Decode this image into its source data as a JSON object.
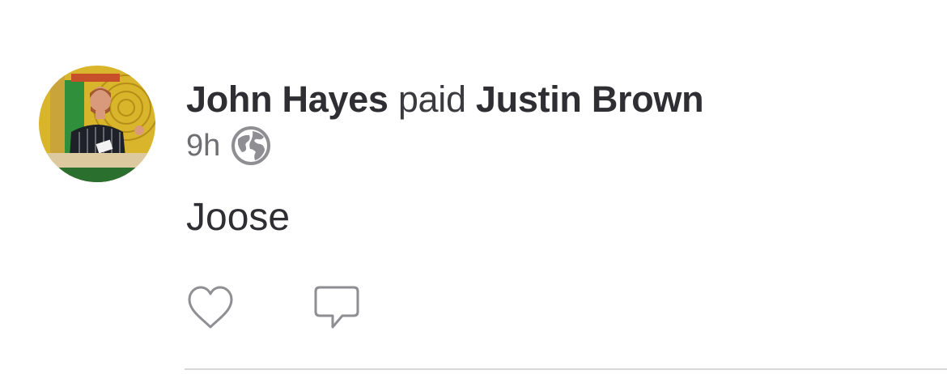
{
  "feed_item": {
    "sender_name": "John Hayes",
    "action_text": "paid",
    "recipient_name": "Justin Brown",
    "time_ago": "9h",
    "audience_icon": "globe-icon",
    "note": "Joose",
    "actions": [
      {
        "icon": "heart-icon"
      },
      {
        "icon": "comment-icon"
      }
    ]
  },
  "colors": {
    "text_primary": "#2f2f33",
    "text_secondary": "#6e6e73",
    "icon_gray": "#8e8e93",
    "divider": "#d7d7db",
    "background": "#ffffff"
  }
}
